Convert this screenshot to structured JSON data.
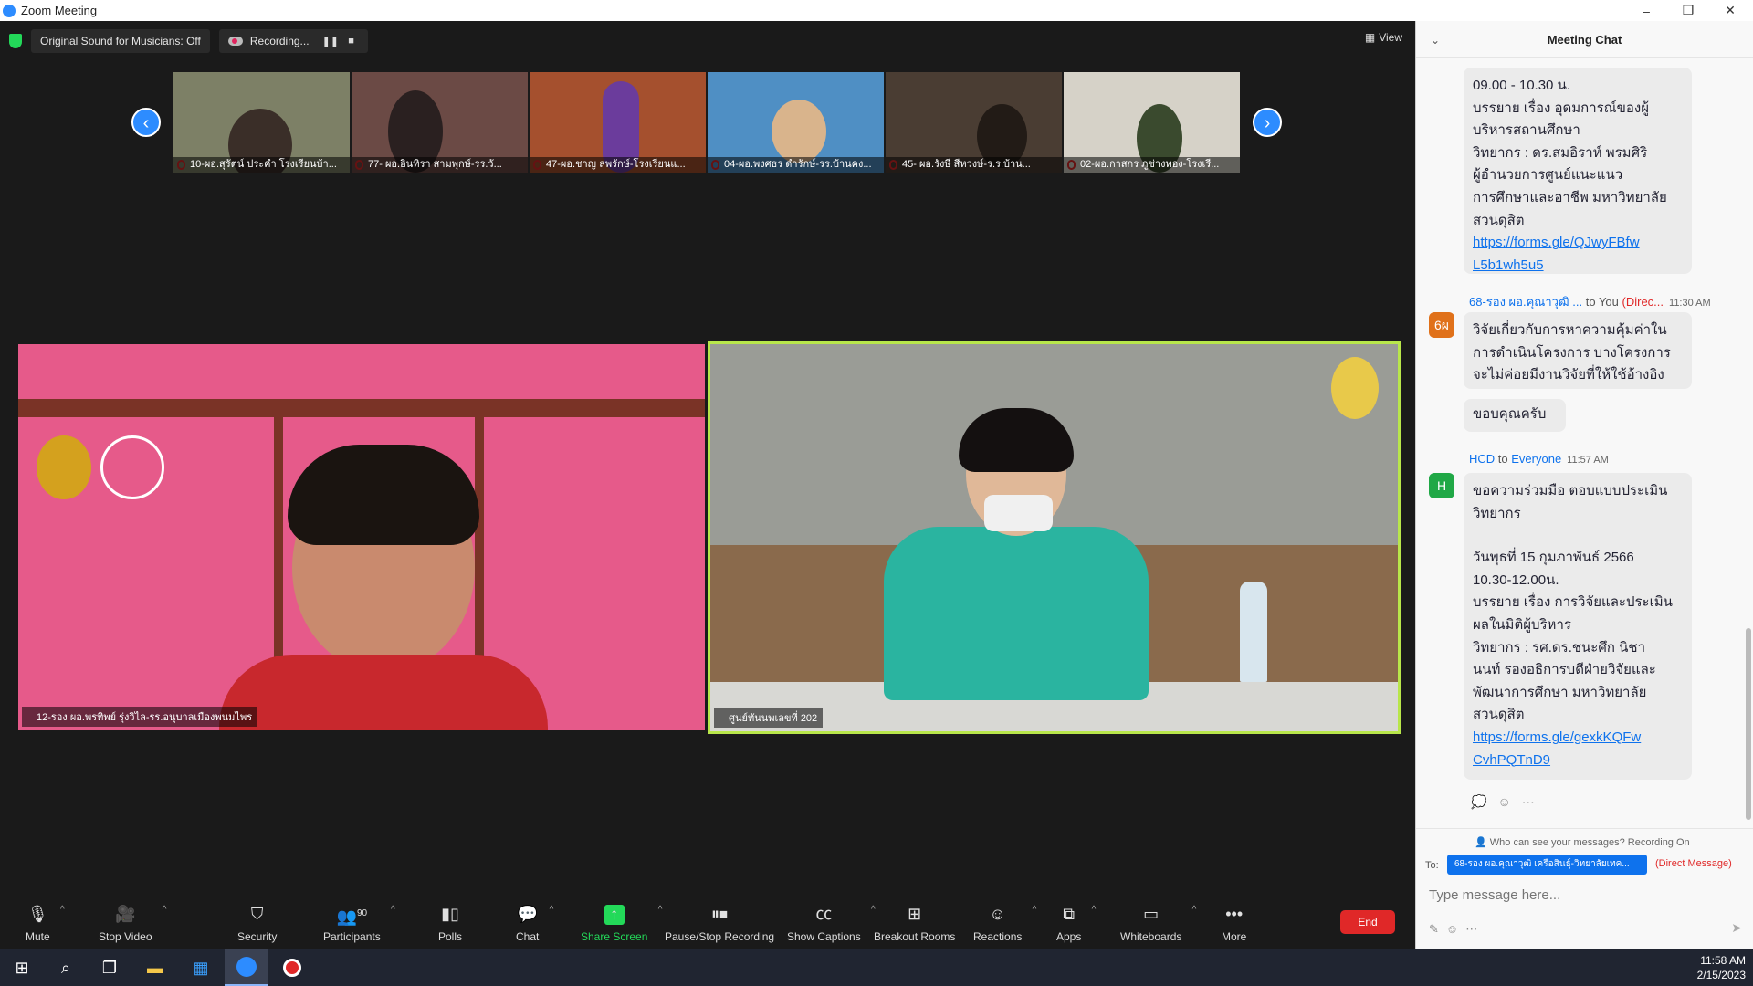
{
  "window": {
    "title": "Zoom Meeting",
    "minimize": "–",
    "restore": "❐",
    "close": "✕"
  },
  "topbar": {
    "sound_label": "Original Sound for Musicians: Off",
    "recording_label": "Recording...",
    "pause": "❚❚",
    "stop": "■",
    "view_label": "View"
  },
  "thumbnails": [
    {
      "name": "10-ผอ.สุรัตน์ ประคำ โรงเรียนบ้า...",
      "bg": "#7d8066"
    },
    {
      "name": "77- ผอ.อินทิรา สามพุกษ์-รร.วั...",
      "bg": "#6b4a45"
    },
    {
      "name": "47-ผอ.ชาญ ลพรักษ์-โรงเรียนแ...",
      "bg": "#a5502e"
    },
    {
      "name": "04-ผอ.พงศธร ดำรักษ์-รร.บ้านคง...",
      "bg": "#4f8fc4"
    },
    {
      "name": "45- ผอ.รังษี สีหวงษ์-ร.ร.บ้าน...",
      "bg": "#4a3d33"
    },
    {
      "name": "02-ผอ.กาสกร ภูช่างทอง-โรงเรี...",
      "bg": "#d6d2c8"
    }
  ],
  "nav": {
    "prev": "‹",
    "next": "›"
  },
  "tiles": [
    {
      "name": "12-รอง ผอ.พรทิพย์ รุ่งวิไล-รร.อนุบาลเมืองพนมไพร",
      "bg": "#e65a8a"
    },
    {
      "name": "ศูนย์ทันนพเลขที่ 202",
      "bg": "#9a9c96"
    }
  ],
  "toolbar": {
    "mute": "Mute",
    "stop_video": "Stop Video",
    "security": "Security",
    "participants": "Participants",
    "participants_count": "90",
    "polls": "Polls",
    "chat": "Chat",
    "share_screen": "Share Screen",
    "pause_stop": "Pause/Stop Recording",
    "captions": "Show Captions",
    "breakout": "Breakout Rooms",
    "reactions": "Reactions",
    "apps": "Apps",
    "whiteboards": "Whiteboards",
    "more": "More",
    "end": "End"
  },
  "chat": {
    "title": "Meeting Chat",
    "messages": [
      {
        "lines": [
          "09.00 - 10.30 น.",
          "บรรยาย เรื่อง อุดมการณ์ของผู้",
          "บริหารสถานศึกษา",
          "วิทยากร : ดร.สมอิราห์ พรมศิริ",
          "ผู้อำนวยการศูนย์แนะแนว",
          "การศึกษาและอาชีพ มหาวิทยาลัย",
          "สวนดุสิต"
        ],
        "link": "https://forms.gle/QJwyFBfwL5b1wh5u5",
        "link_lines": [
          "https://forms.gle/QJwyFBfw",
          "L5b1wh5u5"
        ]
      },
      {
        "sender": "68-รอง ผอ.คุณาวุฒิ ...",
        "to": " to You ",
        "dm": "(Direc...",
        "time": "11:30 AM",
        "avatar": "6ผ",
        "avatar_color": "#e0711a",
        "lines": [
          "วิจัยเกี่ยวกับการหาความคุ้มค่าใน",
          "การดำเนินโครงการ บางโครงการ",
          "จะไม่ค่อยมีงานวิจัยที่ให้ใช้อ้างอิง"
        ],
        "followup": "ขอบคุณครับ"
      },
      {
        "sender": "HCD",
        "to": " to ",
        "to_target": "Everyone",
        "time": "11:57 AM",
        "avatar": "H",
        "avatar_color": "#20a846",
        "lines": [
          "ขอความร่วมมือ ตอบแบบประเมิน",
          "วิทยากร",
          "",
          "วันพุธที่ 15 กุมภาพันธ์ 2566",
          "10.30-12.00น.",
          "บรรยาย เรื่อง การวิจัยและประเมิน",
          "ผลในมิติผู้บริหาร",
          "วิทยากร : รศ.ดร.ชนะศึก นิชา",
          "นนท์ รองอธิการบดีฝ่ายวิจัยและ",
          "พัฒนาการศึกษา มหาวิทยาลัย",
          "สวนดุสิต"
        ],
        "link": "https://forms.gle/gexkKQFwCvhPQTnD9",
        "link_lines": [
          "https://forms.gle/gexkKQFw",
          "CvhPQTnD9"
        ]
      }
    ],
    "who_can_see": "Who can see your messages? Recording On",
    "to_label": "To:",
    "recipient": "68-รอง ผอ.คุณาวุฒิ เครือสินธุ์-วิทยาลัยเทค...",
    "direct_message": "(Direct Message)",
    "placeholder": "Type message here..."
  },
  "taskbar": {
    "time": "11:58 AM",
    "date": "2/15/2023"
  }
}
